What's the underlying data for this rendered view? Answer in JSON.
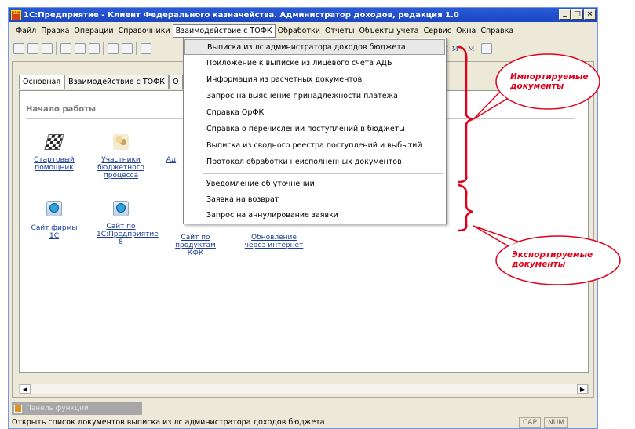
{
  "window": {
    "title": "1С:Предприятие - Клиент Федерального казначейства. Администратор доходов, редакция 1.0"
  },
  "menu": [
    "Файл",
    "Правка",
    "Операции",
    "Справочники",
    "Взаимодействие с ТОФК",
    "Обработки",
    "Отчеты",
    "Объекты учета",
    "Сервис",
    "Окна",
    "Справка"
  ],
  "toolbar": {
    "mem_label": "M M+ M-"
  },
  "tabs": [
    "Основная",
    "Взаимодействие с ТОФК",
    "О"
  ],
  "section_title": "Начало работы",
  "launch_items": [
    {
      "label": "Стартовый помощник",
      "icon": "checkered-flag-icon"
    },
    {
      "label": "Участники бюджетного процесса",
      "icon": "people-icon"
    },
    {
      "label": "Ад",
      "icon": ""
    },
    {
      "label": "Сайт фирмы 1С",
      "icon": "web-icon"
    },
    {
      "label": "Сайт по 1С:Предприятие 8",
      "icon": "web-icon"
    },
    {
      "label": "Сайт по продуктам КФК",
      "icon": ""
    },
    {
      "label": "Обновление через интернет",
      "icon": ""
    }
  ],
  "dropdown": {
    "items": [
      "Выписка из лс администратора доходов бюджета",
      "Приложение к выписке из лицевого счета АДБ",
      "Информация из расчетных документов",
      "Запрос на выяснение принадлежности платежа",
      "Справка ОрФК",
      "Справка о перечислении поступлений в бюджеты",
      "Выписка из сводного реестра поступлений и выбытий",
      "Протокол обработки неисполненных документов",
      "Уведомление об уточнении",
      "Заявка на возврат",
      "Запрос на аннулирование заявки"
    ]
  },
  "callouts": {
    "import": "Импортируемые документы",
    "export": "Экспортируемые документы"
  },
  "panel_functions": "Панель функций",
  "status": {
    "text": "Открыть список документов выписка из лс администратора доходов бюджета",
    "cap": "CAP",
    "num": "NUM"
  },
  "colors": {
    "titlebar": "#1c46c2",
    "callout": "#e0001a",
    "link": "#1c3f95"
  }
}
